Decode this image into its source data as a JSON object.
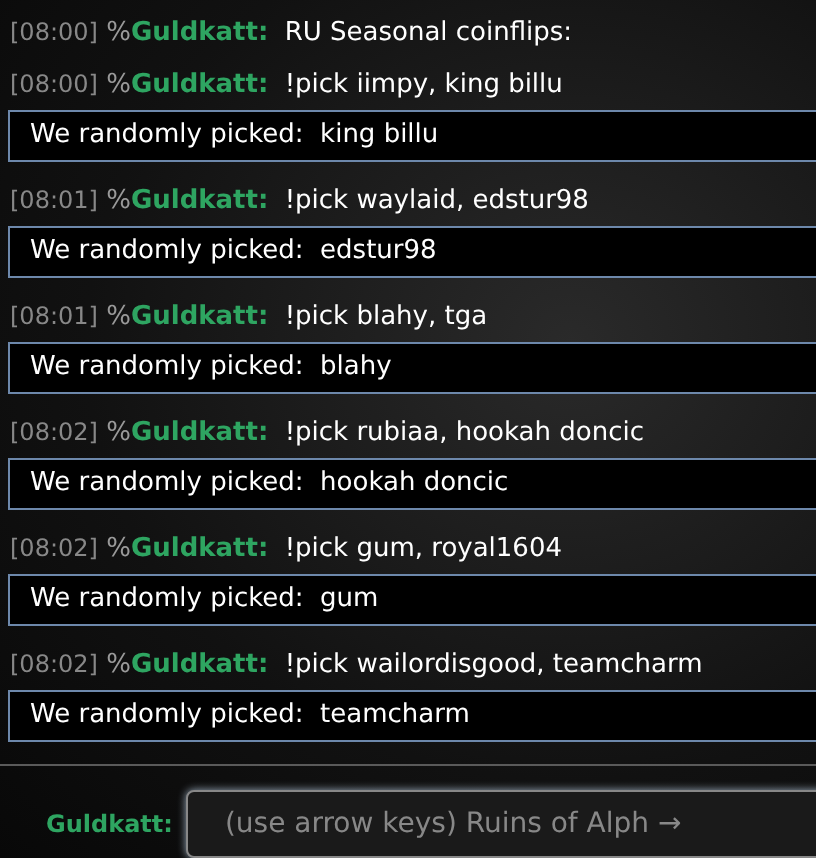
{
  "messages": [
    {
      "kind": "chat",
      "time": "[08:00]",
      "rank": "%",
      "user": "Guldkatt:",
      "text": "RU Seasonal coinflips:"
    },
    {
      "kind": "chat",
      "time": "[08:00]",
      "rank": "%",
      "user": "Guldkatt:",
      "text": "!pick iimpy, king billu"
    },
    {
      "kind": "result",
      "label": "We randomly picked:",
      "value": "king billu"
    },
    {
      "kind": "chat",
      "time": "[08:01]",
      "rank": "%",
      "user": "Guldkatt:",
      "text": "!pick waylaid, edstur98"
    },
    {
      "kind": "result",
      "label": "We randomly picked:",
      "value": "edstur98"
    },
    {
      "kind": "chat",
      "time": "[08:01]",
      "rank": "%",
      "user": "Guldkatt:",
      "text": "!pick blahy, tga"
    },
    {
      "kind": "result",
      "label": "We randomly picked:",
      "value": "blahy"
    },
    {
      "kind": "chat",
      "time": "[08:02]",
      "rank": "%",
      "user": "Guldkatt:",
      "text": "!pick rubiaa, hookah doncic"
    },
    {
      "kind": "result",
      "label": "We randomly picked:",
      "value": "hookah doncic"
    },
    {
      "kind": "chat",
      "time": "[08:02]",
      "rank": "%",
      "user": "Guldkatt:",
      "text": "!pick gum, royal1604"
    },
    {
      "kind": "result",
      "label": "We randomly picked:",
      "value": "gum"
    },
    {
      "kind": "chat",
      "time": "[08:02]",
      "rank": "%",
      "user": "Guldkatt:",
      "text": "!pick wailordisgood, teamcharm"
    },
    {
      "kind": "result",
      "label": "We randomly picked:",
      "value": "teamcharm"
    }
  ],
  "composer": {
    "user": "Guldkatt:",
    "placeholder": "(use arrow keys) Ruins of Alph →"
  }
}
